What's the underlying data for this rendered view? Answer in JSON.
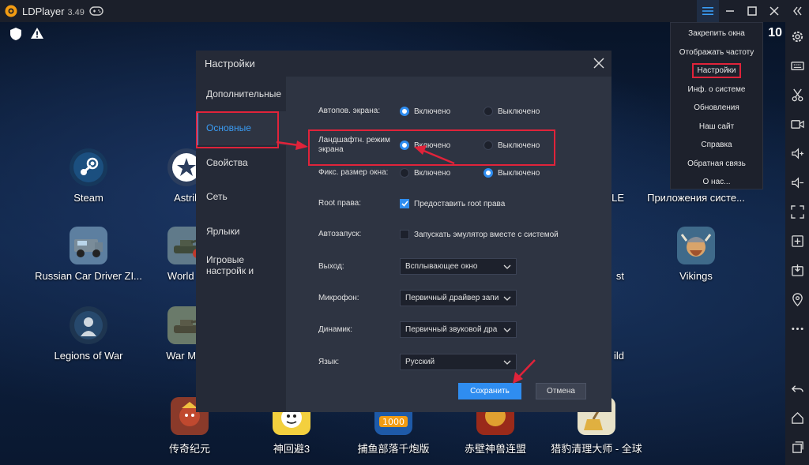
{
  "window": {
    "title": "LDPlayer",
    "version": "3.49"
  },
  "status": {
    "clock": "10"
  },
  "desktop_apps": [
    {
      "label": "Steam"
    },
    {
      "label": "Astrill "
    },
    {
      "label": "Russian Car Driver ZI..."
    },
    {
      "label": "World of"
    },
    {
      "label": "Legions of War"
    },
    {
      "label": "War Mac"
    },
    {
      "label": "传奇纪元"
    },
    {
      "label": "神回避3"
    },
    {
      "label": "捕鱼部落千炮版"
    },
    {
      "label": "赤壁神兽连盟"
    },
    {
      "label": "猎豹清理大师 - 全球"
    },
    {
      "label": "Приложения систе..."
    },
    {
      "label": "Vikings"
    },
    {
      "label": "ILE"
    },
    {
      "label": "st"
    },
    {
      "label": "ild"
    }
  ],
  "menu": {
    "items": [
      "Закрепить окна",
      "Отображать частоту",
      "Настройки",
      "Инф. о системе",
      "Обновления",
      "Наш сайт",
      "Справка",
      "Обратная связь",
      "О нас..."
    ]
  },
  "dialog": {
    "title": "Настройки",
    "sidebar": [
      "Дополнительные",
      "Основные",
      "Свойства",
      "Сеть",
      "Ярлыки",
      "Игровые настройк и"
    ],
    "rows": {
      "auto_rotate": {
        "label": "Автопов. экрана:",
        "on": "Включено",
        "off": "Выключено"
      },
      "landscape": {
        "label": "Ландшафтн. режим экрана",
        "on": "Включено",
        "off": "Выключено"
      },
      "fixed_size": {
        "label": "Фикс. размер окна:",
        "on": "Включено",
        "off": "Выключено"
      },
      "root": {
        "label": "Root права:",
        "text": "Предоставить root права"
      },
      "autostart": {
        "label": "Автозапуск:",
        "text": "Запускать эмулятор вместе с системой"
      },
      "exit": {
        "label": "Выход:",
        "value": "Всплывающее окно"
      },
      "mic": {
        "label": "Микрофон:",
        "value": "Первичный драйвер запи"
      },
      "speaker": {
        "label": "Динамик:",
        "value": "Первичный звуковой дра"
      },
      "language": {
        "label": "Язык:",
        "value": "Русский"
      }
    },
    "save": "Сохранить",
    "cancel": "Отмена"
  },
  "colors": {
    "accent": "#2f8df0",
    "highlight": "#e0233a",
    "panel": "#2e3442"
  }
}
